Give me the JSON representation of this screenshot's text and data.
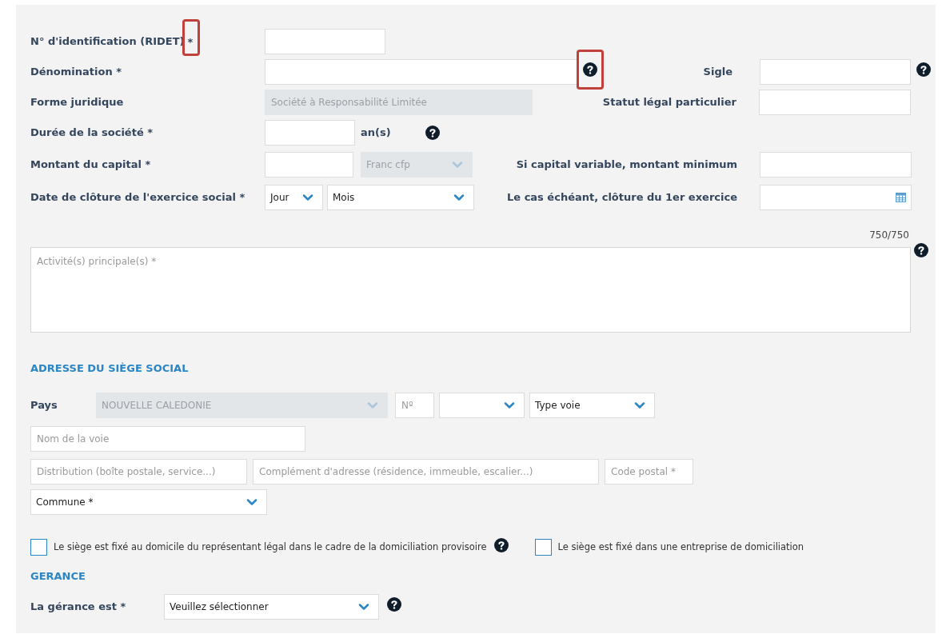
{
  "identification": {
    "label": "N° d'identification (RIDET)",
    "required_mark": "*",
    "mark_highlighted": true
  },
  "denomination": {
    "label": "Dénomination *",
    "help_highlighted": true
  },
  "sigle": {
    "label": "Sigle"
  },
  "forme_juridique": {
    "label": "Forme juridique",
    "value": "Société à Responsabilité Limitée",
    "disabled": true
  },
  "statut": {
    "label": "Statut légal particulier"
  },
  "duree": {
    "label": "Durée de la société *",
    "unit": "an(s)"
  },
  "capital": {
    "label": "Montant du capital *",
    "currency": {
      "value": "Franc cfp",
      "disabled": true
    }
  },
  "capital_variable": {
    "label": "Si capital variable, montant minimum"
  },
  "date_cloture": {
    "label": "Date de clôture de l'exercice social *",
    "day": "Jour",
    "month": "Mois"
  },
  "premiere_cloture": {
    "label": "Le cas échéant, clôture du 1er exercice"
  },
  "activite": {
    "placeholder": "Activité(s) principale(s) *",
    "counter": "750/750"
  },
  "adresse": {
    "heading": "ADRESSE DU SIÈGE SOCIAL",
    "pays_label": "Pays",
    "pays": {
      "value": "NOUVELLE CALEDONIE",
      "disabled": true
    },
    "numero_placeholder": "Nº",
    "type_voie": "Type voie",
    "nom_voie_placeholder": "Nom de la voie",
    "distribution_placeholder": "Distribution (boîte postale, service...)",
    "complement_placeholder": "Complément d'adresse (résidence, immeuble, escalier...)",
    "code_postal_placeholder": "Code postal *",
    "commune": "Commune *"
  },
  "checkboxes": [
    {
      "label": "Le siège est fixé au domicile du représentant légal dans le cadre de la domiciliation provisoire",
      "checked": false,
      "help": true
    },
    {
      "label": "Le siège est fixé dans une entreprise de domiciliation",
      "checked": false,
      "help": false
    }
  ],
  "gerance": {
    "heading": "GERANCE",
    "label": "La gérance est *",
    "select": "Veuillez sélectionner"
  }
}
